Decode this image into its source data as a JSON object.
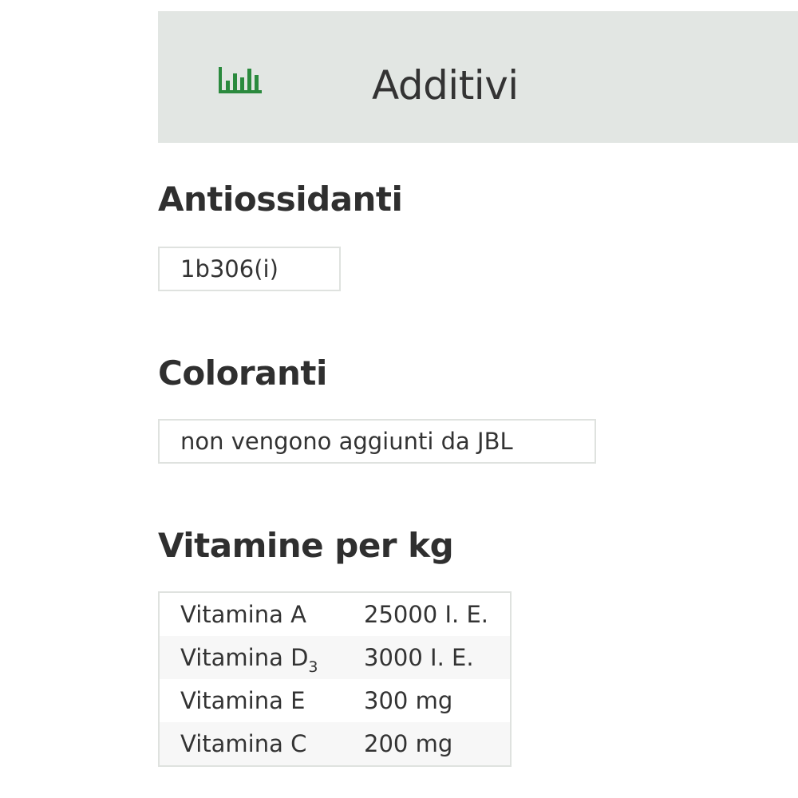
{
  "header": {
    "icon": "bar-chart-icon",
    "title": "Additivi",
    "accent_color": "#2b8a3e",
    "background_color": "#e2e6e3"
  },
  "sections": {
    "antioxidants": {
      "title": "Antiossidanti",
      "value": "1b306(i)"
    },
    "colorants": {
      "title": "Coloranti",
      "value": "non vengono aggiunti da JBL"
    },
    "vitamins": {
      "title": "Vitamine per kg",
      "rows": [
        {
          "name": "Vitamina A",
          "subscript": "",
          "amount": "25000 I. E."
        },
        {
          "name": "Vitamina D",
          "subscript": "3",
          "amount": "3000 I. E."
        },
        {
          "name": "Vitamina E",
          "subscript": "",
          "amount": "300 mg"
        },
        {
          "name": "Vitamina C",
          "subscript": "",
          "amount": "200 mg"
        }
      ]
    }
  }
}
